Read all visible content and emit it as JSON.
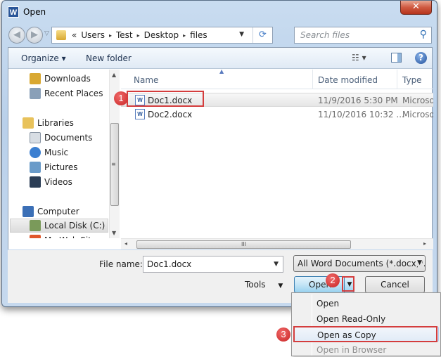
{
  "window": {
    "title": "Open",
    "app_icon_letter": "W",
    "close_glyph": "✕"
  },
  "nav": {
    "back_glyph": "◀",
    "forward_glyph": "▶",
    "history_glyph": "▽",
    "breadcrumb": [
      "«",
      "Users",
      "Test",
      "Desktop",
      "files"
    ],
    "crumb_sep": "▸",
    "address_drop_glyph": "▼",
    "refresh_glyph": "⟳",
    "search_placeholder": "Search files",
    "search_glyph": "⚲"
  },
  "toolbar": {
    "organize_label": "Organize ▾",
    "new_folder_label": "New folder",
    "view_label": "☷ ▾",
    "help_label": "?"
  },
  "sidebar": {
    "items": [
      {
        "label": "Downloads",
        "icon": "downloads-icon",
        "color": "#d9a832"
      },
      {
        "label": "Recent Places",
        "icon": "recent-places-icon",
        "color": "#8aa0b8"
      },
      {
        "label": "Libraries",
        "icon": "libraries-icon",
        "color": "#e8c25b"
      },
      {
        "label": "Documents",
        "icon": "documents-icon",
        "color": "#d7dde4"
      },
      {
        "label": "Music",
        "icon": "music-icon",
        "color": "#3b7fd1"
      },
      {
        "label": "Pictures",
        "icon": "pictures-icon",
        "color": "#6a9bc9"
      },
      {
        "label": "Videos",
        "icon": "videos-icon",
        "color": "#2b3d55"
      },
      {
        "label": "Computer",
        "icon": "computer-icon",
        "color": "#3b6fb6"
      },
      {
        "label": "Local Disk (C:)",
        "icon": "local-disk-icon",
        "color": "#7a9a5a"
      },
      {
        "label": "My Web Sites on",
        "icon": "web-sites-icon",
        "color": "#e0572b"
      }
    ],
    "scroll_up": "▲",
    "scroll_down": "▼",
    "scroll_grip": "≡"
  },
  "files": {
    "columns": [
      "Name",
      "Date modified",
      "Type"
    ],
    "sort_glyph": "▲",
    "rows": [
      {
        "name": "Doc1.docx",
        "date": "11/9/2016 5:30 PM",
        "type": "Microsoft",
        "selected": true
      },
      {
        "name": "Doc2.docx",
        "date": "11/10/2016 10:32 ...",
        "type": "Microsoft",
        "selected": false
      }
    ],
    "file_icon_letter": "W",
    "hscroll_left": "◂",
    "hscroll_right": "▸",
    "hscroll_grip": "III"
  },
  "bottom": {
    "file_name_label": "File name:",
    "file_name_value": "Doc1.docx",
    "file_type_value": "All Word Documents (*.docx;*.docm",
    "dropdown_glyph": "▼",
    "tools_label": "Tools",
    "open_label": "Open",
    "cancel_label": "Cancel"
  },
  "open_menu": {
    "items": [
      {
        "label": "Open",
        "disabled": false
      },
      {
        "label": "Open Read-Only",
        "disabled": false
      },
      {
        "label": "Open as Copy",
        "disabled": false,
        "highlighted": true
      },
      {
        "label": "Open in Browser",
        "disabled": true
      }
    ]
  },
  "annotations": {
    "step1": "1",
    "step2": "2",
    "step3": "3",
    "highlight_color": "#d43d3d"
  }
}
